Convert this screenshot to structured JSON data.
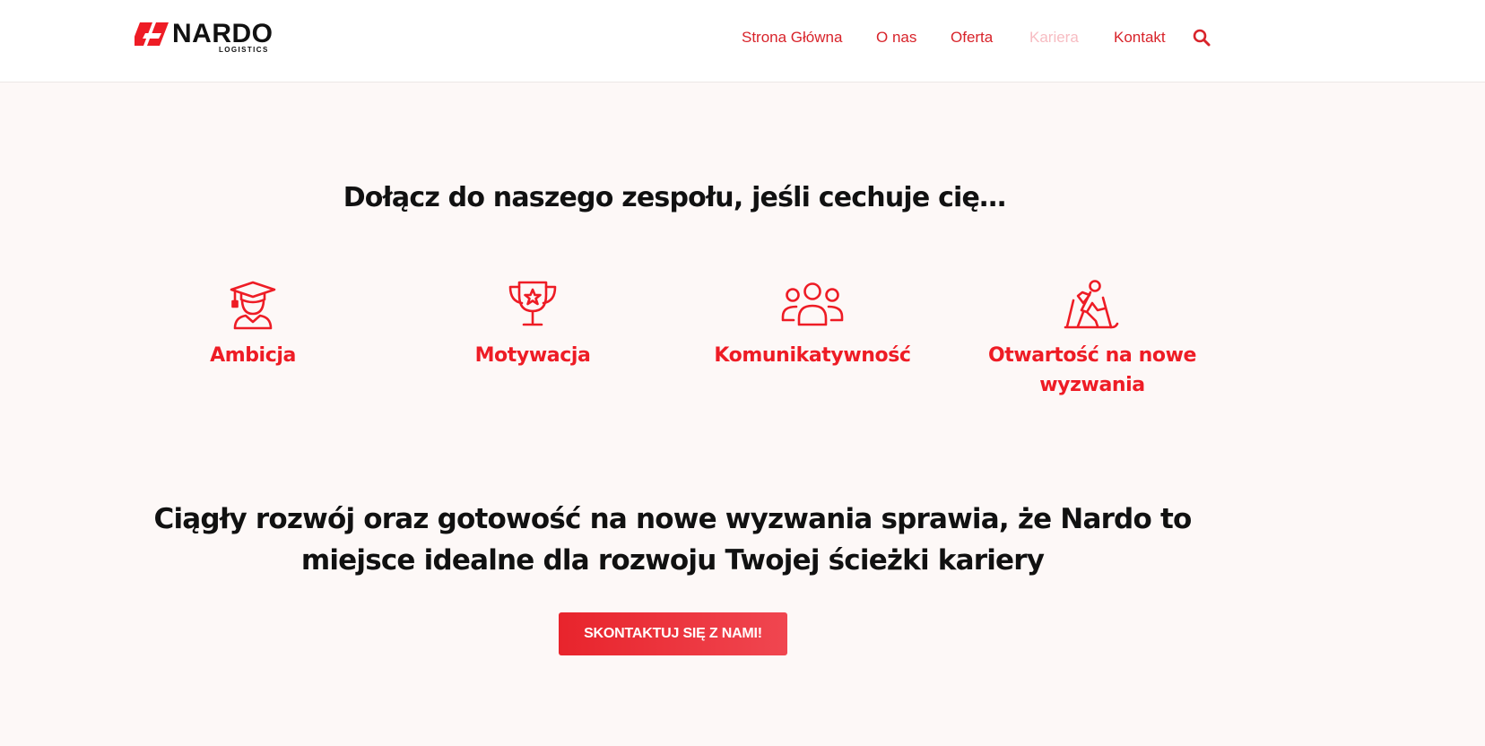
{
  "brand": {
    "name": "NARDO",
    "sub": "LOGISTICS",
    "accent": "#ee1c25"
  },
  "nav": {
    "items": [
      {
        "label": "Strona Główna",
        "active": false
      },
      {
        "label": "O nas",
        "active": false
      },
      {
        "label": "Oferta",
        "active": false
      },
      {
        "label": "Kariera",
        "active": true
      },
      {
        "label": "Kontakt",
        "active": false
      }
    ],
    "search_icon": "search-icon"
  },
  "section": {
    "heading": "Dołącz do naszego zespołu, jeśli cechuje cię…",
    "traits": [
      {
        "icon": "graduate-icon",
        "label": "Ambicja"
      },
      {
        "icon": "trophy-icon",
        "label": "Motywacja"
      },
      {
        "icon": "people-group-icon",
        "label": "Komunikatywność"
      },
      {
        "icon": "hiker-icon",
        "label": "Otwartość na nowe wyzwania"
      }
    ],
    "statement": "Ciągły rozwój oraz gotowość na nowe wyzwania sprawia, że Nardo to miejsce idealne dla rozwoju Twojej ścieżki kariery",
    "cta_label": "SKONTAKTUJ SIĘ Z NAMI!"
  }
}
